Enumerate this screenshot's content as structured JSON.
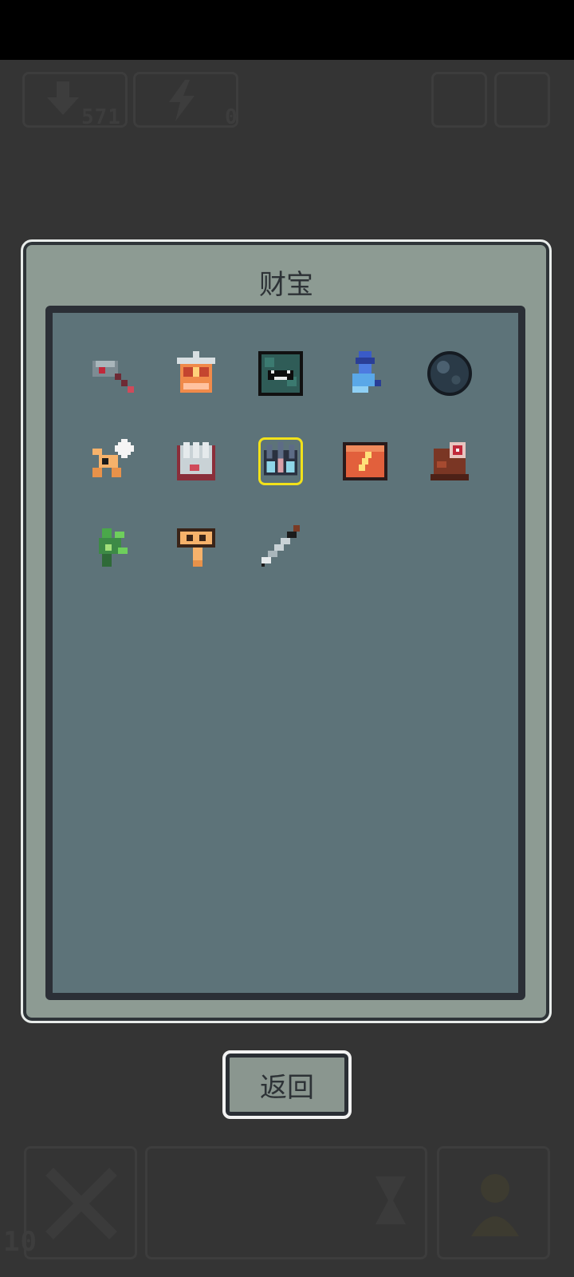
{
  "hud": {
    "downloads_count": "571",
    "energy_count": "0",
    "level_number": "10"
  },
  "panel": {
    "title": "财宝"
  },
  "treasures": [
    {
      "name": "hammer",
      "icon": "hammer-icon"
    },
    {
      "name": "lantern",
      "icon": "lantern-icon"
    },
    {
      "name": "dark-box",
      "icon": "monster-box-icon"
    },
    {
      "name": "blue-rabbit",
      "icon": "blue-rabbit-icon"
    },
    {
      "name": "dark-orb",
      "icon": "dark-orb-icon"
    },
    {
      "name": "spark-star",
      "icon": "spark-star-icon"
    },
    {
      "name": "glove",
      "icon": "glove-icon"
    },
    {
      "name": "crystal-crown",
      "icon": "crystal-crown-icon",
      "selected": true
    },
    {
      "name": "lightning-chest",
      "icon": "lightning-chest-icon"
    },
    {
      "name": "brown-totem",
      "icon": "totem-icon"
    },
    {
      "name": "green-sprout",
      "icon": "sprout-icon"
    },
    {
      "name": "key",
      "icon": "key-icon"
    },
    {
      "name": "dagger",
      "icon": "dagger-icon"
    }
  ],
  "buttons": {
    "back_label": "返回"
  }
}
